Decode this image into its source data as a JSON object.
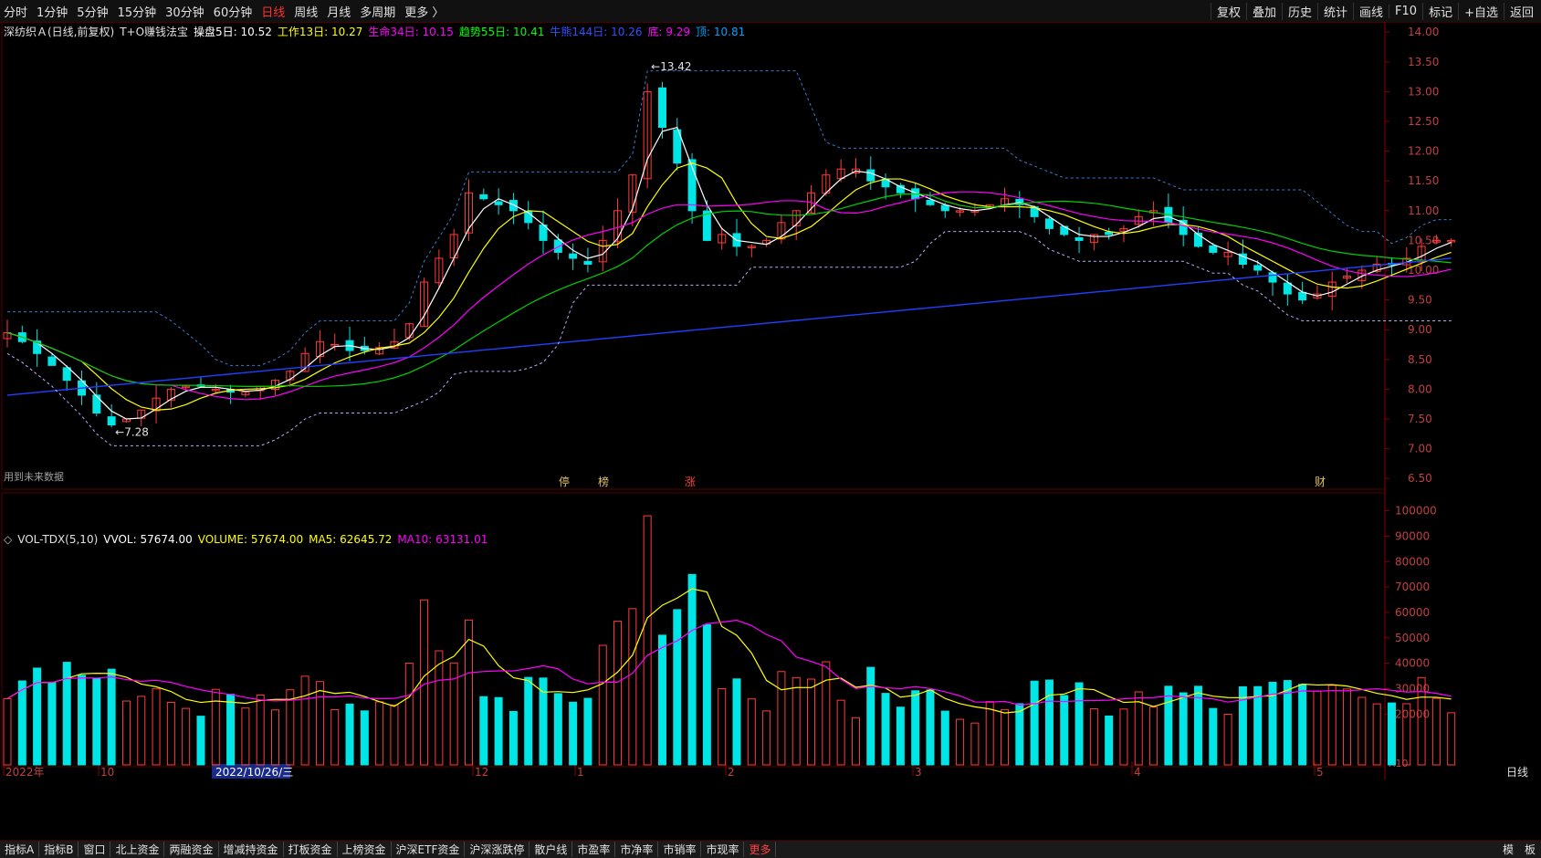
{
  "toolbar": {
    "periods": [
      "分时",
      "1分钟",
      "5分钟",
      "15分钟",
      "30分钟",
      "60分钟",
      "日线",
      "周线",
      "月线",
      "多周期",
      "更多 〉"
    ],
    "active_period": "日线",
    "right_buttons": [
      "复权",
      "叠加",
      "历史",
      "统计",
      "画线",
      "F10",
      "标记",
      "+自选",
      "返回"
    ]
  },
  "main_legend": {
    "stock": "深纺织Ａ(日线,前复权)",
    "indicator": "T+O赚钱法宝",
    "items": [
      {
        "label": "操盘5日: 10.52",
        "color": "#ffffff"
      },
      {
        "label": "工作13日: 10.27",
        "color": "#ffff00"
      },
      {
        "label": "生命34日: 10.15",
        "color": "#ff00ff"
      },
      {
        "label": "趋势55日: 10.41",
        "color": "#00ff00"
      },
      {
        "label": "牛熊144日: 10.26",
        "color": "#3050ff"
      },
      {
        "label": "底: 9.29",
        "color": "#ff00ff"
      },
      {
        "label": "顶: 10.81",
        "color": "#00a0ff"
      }
    ]
  },
  "vol_legend": {
    "name": "VOL-TDX(5,10)",
    "items": [
      {
        "label": "VVOL: 57674.00",
        "color": "#ffffff"
      },
      {
        "label": "VOLUME: 57674.00",
        "color": "#ffff00"
      },
      {
        "label": "MA5: 62645.72",
        "color": "#ffff00"
      },
      {
        "label": "MA10: 63131.01",
        "color": "#ff00ff"
      }
    ]
  },
  "chart_data": {
    "type": "candlestick",
    "price_axis": {
      "ticks": [
        "14.00",
        "13.50",
        "13.00",
        "12.50",
        "12.00",
        "11.50",
        "11.00",
        "10.50",
        "10.00",
        "9.50",
        "9.00",
        "8.50",
        "8.00",
        "7.50",
        "7.00",
        "6.50"
      ],
      "range": [
        6.35,
        14.08
      ]
    },
    "volume_axis": {
      "ticks": [
        "100000",
        "90000",
        "80000",
        "70000",
        "60000",
        "50000",
        "40000",
        "30000",
        "20000"
      ],
      "unit_label": "X10",
      "range": [
        0,
        102000
      ]
    },
    "date_labels": [
      "2022年",
      "10",
      "2022/10/26/三",
      "12",
      "1",
      "2",
      "3",
      "4",
      "5"
    ],
    "period_label": "日线",
    "max_label": "13.42",
    "min_label": "7.28",
    "future_data_note": "用到未来数据",
    "event_markers": [
      "停",
      "榜",
      "涨",
      "财"
    ],
    "ma_close_legend_values": {
      "ma5": 10.52,
      "ma13": 10.27,
      "ma34": 10.15,
      "ma55": 10.41,
      "ma144": 10.26,
      "bottom": 9.29,
      "top": 10.81
    },
    "approx_close_series": [
      8.95,
      8.8,
      8.6,
      8.4,
      8.15,
      7.9,
      7.6,
      7.4,
      7.5,
      7.65,
      7.85,
      8.0,
      8.05,
      8.05,
      8.0,
      7.95,
      7.95,
      8.05,
      8.15,
      8.3,
      8.6,
      8.8,
      8.75,
      8.65,
      8.65,
      8.7,
      8.8,
      9.1,
      9.8,
      10.2,
      10.6,
      11.3,
      11.2,
      11.1,
      11.0,
      10.8,
      10.5,
      10.3,
      10.2,
      10.1,
      10.5,
      11.0,
      11.6,
      13.0,
      12.4,
      11.8,
      11.0,
      10.5,
      10.6,
      10.4,
      10.4,
      10.5,
      10.8,
      11.0,
      11.3,
      11.6,
      11.7,
      11.7,
      11.5,
      11.4,
      11.3,
      11.2,
      11.1,
      11.0,
      11.0,
      11.0,
      11.1,
      11.2,
      11.1,
      10.9,
      10.7,
      10.6,
      10.5,
      10.6,
      10.6,
      10.7,
      10.9,
      11.0,
      10.8,
      10.6,
      10.4,
      10.3,
      10.3,
      10.1,
      10.0,
      9.8,
      9.6,
      9.5,
      9.6,
      9.8,
      9.9,
      10.0,
      10.1,
      10.1,
      10.2,
      10.4,
      10.5,
      10.5
    ]
  },
  "bottom_tabs": [
    "指标A",
    "指标B",
    "窗口",
    "北上资金",
    "两融资金",
    "增减持资金",
    "打板资金",
    "上榜资金",
    "沪深ETF资金",
    "沪深涨跌停",
    "散户线",
    "市盈率",
    "市净率",
    "市销率",
    "市现率",
    "更多"
  ],
  "bottom_right": [
    "模",
    "板"
  ]
}
